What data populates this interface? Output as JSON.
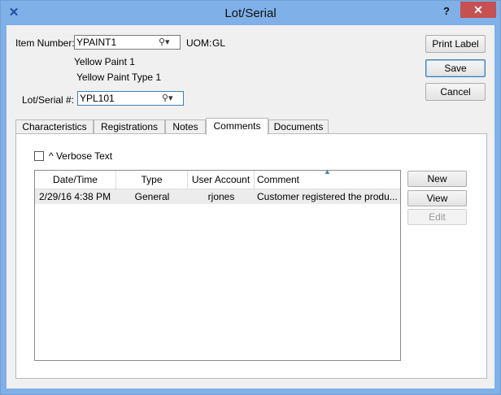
{
  "window": {
    "title": "Lot/Serial",
    "help_label": "?",
    "close_label": "✕"
  },
  "header": {
    "item_number_label": "Item Number:",
    "item_number_value": "YPAINT1",
    "uom_label": "UOM:",
    "uom_value": "GL",
    "description1": "Yellow Paint 1",
    "description2": "Yellow Paint Type 1",
    "lot_serial_label": "Lot/Serial #:",
    "lot_serial_value": "YPL101"
  },
  "buttons": {
    "print_label": "Print Label",
    "save": "Save",
    "cancel": "Cancel"
  },
  "tabs": [
    {
      "label": "Characteristics"
    },
    {
      "label": "Registrations"
    },
    {
      "label": "Notes"
    },
    {
      "label": "Comments"
    },
    {
      "label": "Documents"
    }
  ],
  "comments": {
    "verbose_label": "Verbose Text",
    "verbose_checked": false,
    "columns": [
      "Date/Time",
      "Type",
      "User Account",
      "Comment"
    ],
    "rows": [
      {
        "datetime": "2/29/16 4:38 PM",
        "type": "General",
        "user": "rjones",
        "comment": "Customer registered the produ..."
      }
    ],
    "new_label": "New",
    "view_label": "View",
    "edit_label": "Edit"
  },
  "icons": {
    "app": "xtuple-x-icon",
    "lookup": "magnifier-dropdown-icon",
    "sort": "sort-ascending-icon"
  },
  "colors": {
    "titlebar": "#7fb0e8",
    "close": "#c75050",
    "focus_border": "#3c7fb1",
    "row_selected": "#ececec"
  }
}
